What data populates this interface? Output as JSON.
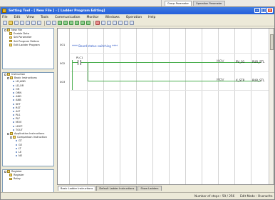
{
  "background": {
    "tabs": [
      "Group Parameter",
      "Operation Parameter"
    ]
  },
  "window": {
    "title": "Setting Tool - [ New File ] - [ Ladder Program Editing]"
  },
  "menu": [
    "File",
    "Edit",
    "View",
    "Tools",
    "Communication",
    "Monitor",
    "Windows",
    "Operation",
    "Help"
  ],
  "project_tree": {
    "root": "New File",
    "items": [
      "Enable Data",
      "Set Parameter",
      "Set Program Pattern",
      "Edit Ladder Program"
    ]
  },
  "instruction_tree": {
    "root": "Instruction",
    "group1": "Basic Instructions",
    "basic": [
      "LD,AND",
      "LD,OR",
      "OR",
      "ORN",
      "AND",
      "ANB",
      "SET",
      "RST",
      "ALT",
      "PLS",
      "PLF",
      "MOV",
      "LDCP",
      "TOUT"
    ],
    "group2": "Application Instructions",
    "sub2": "Comparison Instruction",
    "cmp": [
      "GT",
      "GE",
      "LT",
      "LE",
      "NE"
    ]
  },
  "register_tree": {
    "root": "Register",
    "items": [
      "Register",
      "Relay"
    ]
  },
  "ladder": {
    "rows": [
      "001",
      "002",
      "003"
    ],
    "comment": "**** Board status switching ****",
    "contact_label": "PLC1",
    "rung1": {
      "op": "MOV",
      "a": "PV_01",
      "b": "PUR_STL"
    },
    "rung2": {
      "op": "MOV",
      "a": "X_STP",
      "b": "PUR_STL"
    }
  },
  "tabs": [
    "Basic Ladder Instructions",
    "Default Ladder Instructions",
    "Show Ladders"
  ],
  "status": {
    "steps": "Number of steps : 59 / 256",
    "mode": "Edit Mode : Overwrite"
  }
}
